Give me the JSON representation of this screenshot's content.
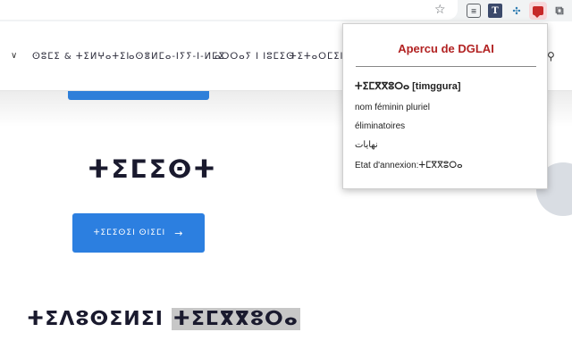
{
  "nav": {
    "items": [
      "ⵙⵓⵎⵉ & ⵜⵉⵍⵖⴰⵜⵉⵏ",
      "ⴰⵙⴻⵍⵎⴰ-ⵏⵢⵢ-ⵏ-ⵍⵎⵉ",
      "ⴰⵔⵔⴰⵢ ⵏ ⵏⵓⵎⵉⵙ",
      "ⵜⵉⵜⴰⵔⵎⵉⵏ ⵏ"
    ]
  },
  "hero": {
    "heading": "ⵜⵉⵎⵉⵙⵜ",
    "cta_label": "ⵜⵉⵎⵉⵙⵉⵏ ⵙⵏⵉⵎⵏ",
    "title_prefix": "ⵜⵉⴷⵓⵙⵉⵍⵉⵏ",
    "title_highlight": "ⵜⵉⵎⴳⴳⵓⵔⴰ"
  },
  "popup": {
    "title": "Apercu de DGLAI",
    "word": "ⵜⵉⵎⴳⴳⵓⵔⴰ [timggura]",
    "category": "nom féminin pluriel",
    "gloss_fr": "éliminatoires",
    "gloss_ar": "نهايات",
    "annexion": "Etat d'annexion:ⵜⵎⴳⴳⵓⵔⴰ"
  },
  "icons": {
    "star": "bookmark-star-icon",
    "extensions": [
      "translate-icon",
      "dictionary-icon",
      "network-icon",
      "dglai-extension-icon",
      "puzzle-icon"
    ],
    "nav_search": "search-icon"
  },
  "colors": {
    "accent": "#2c7fe0",
    "popup_title": "#b22222"
  }
}
